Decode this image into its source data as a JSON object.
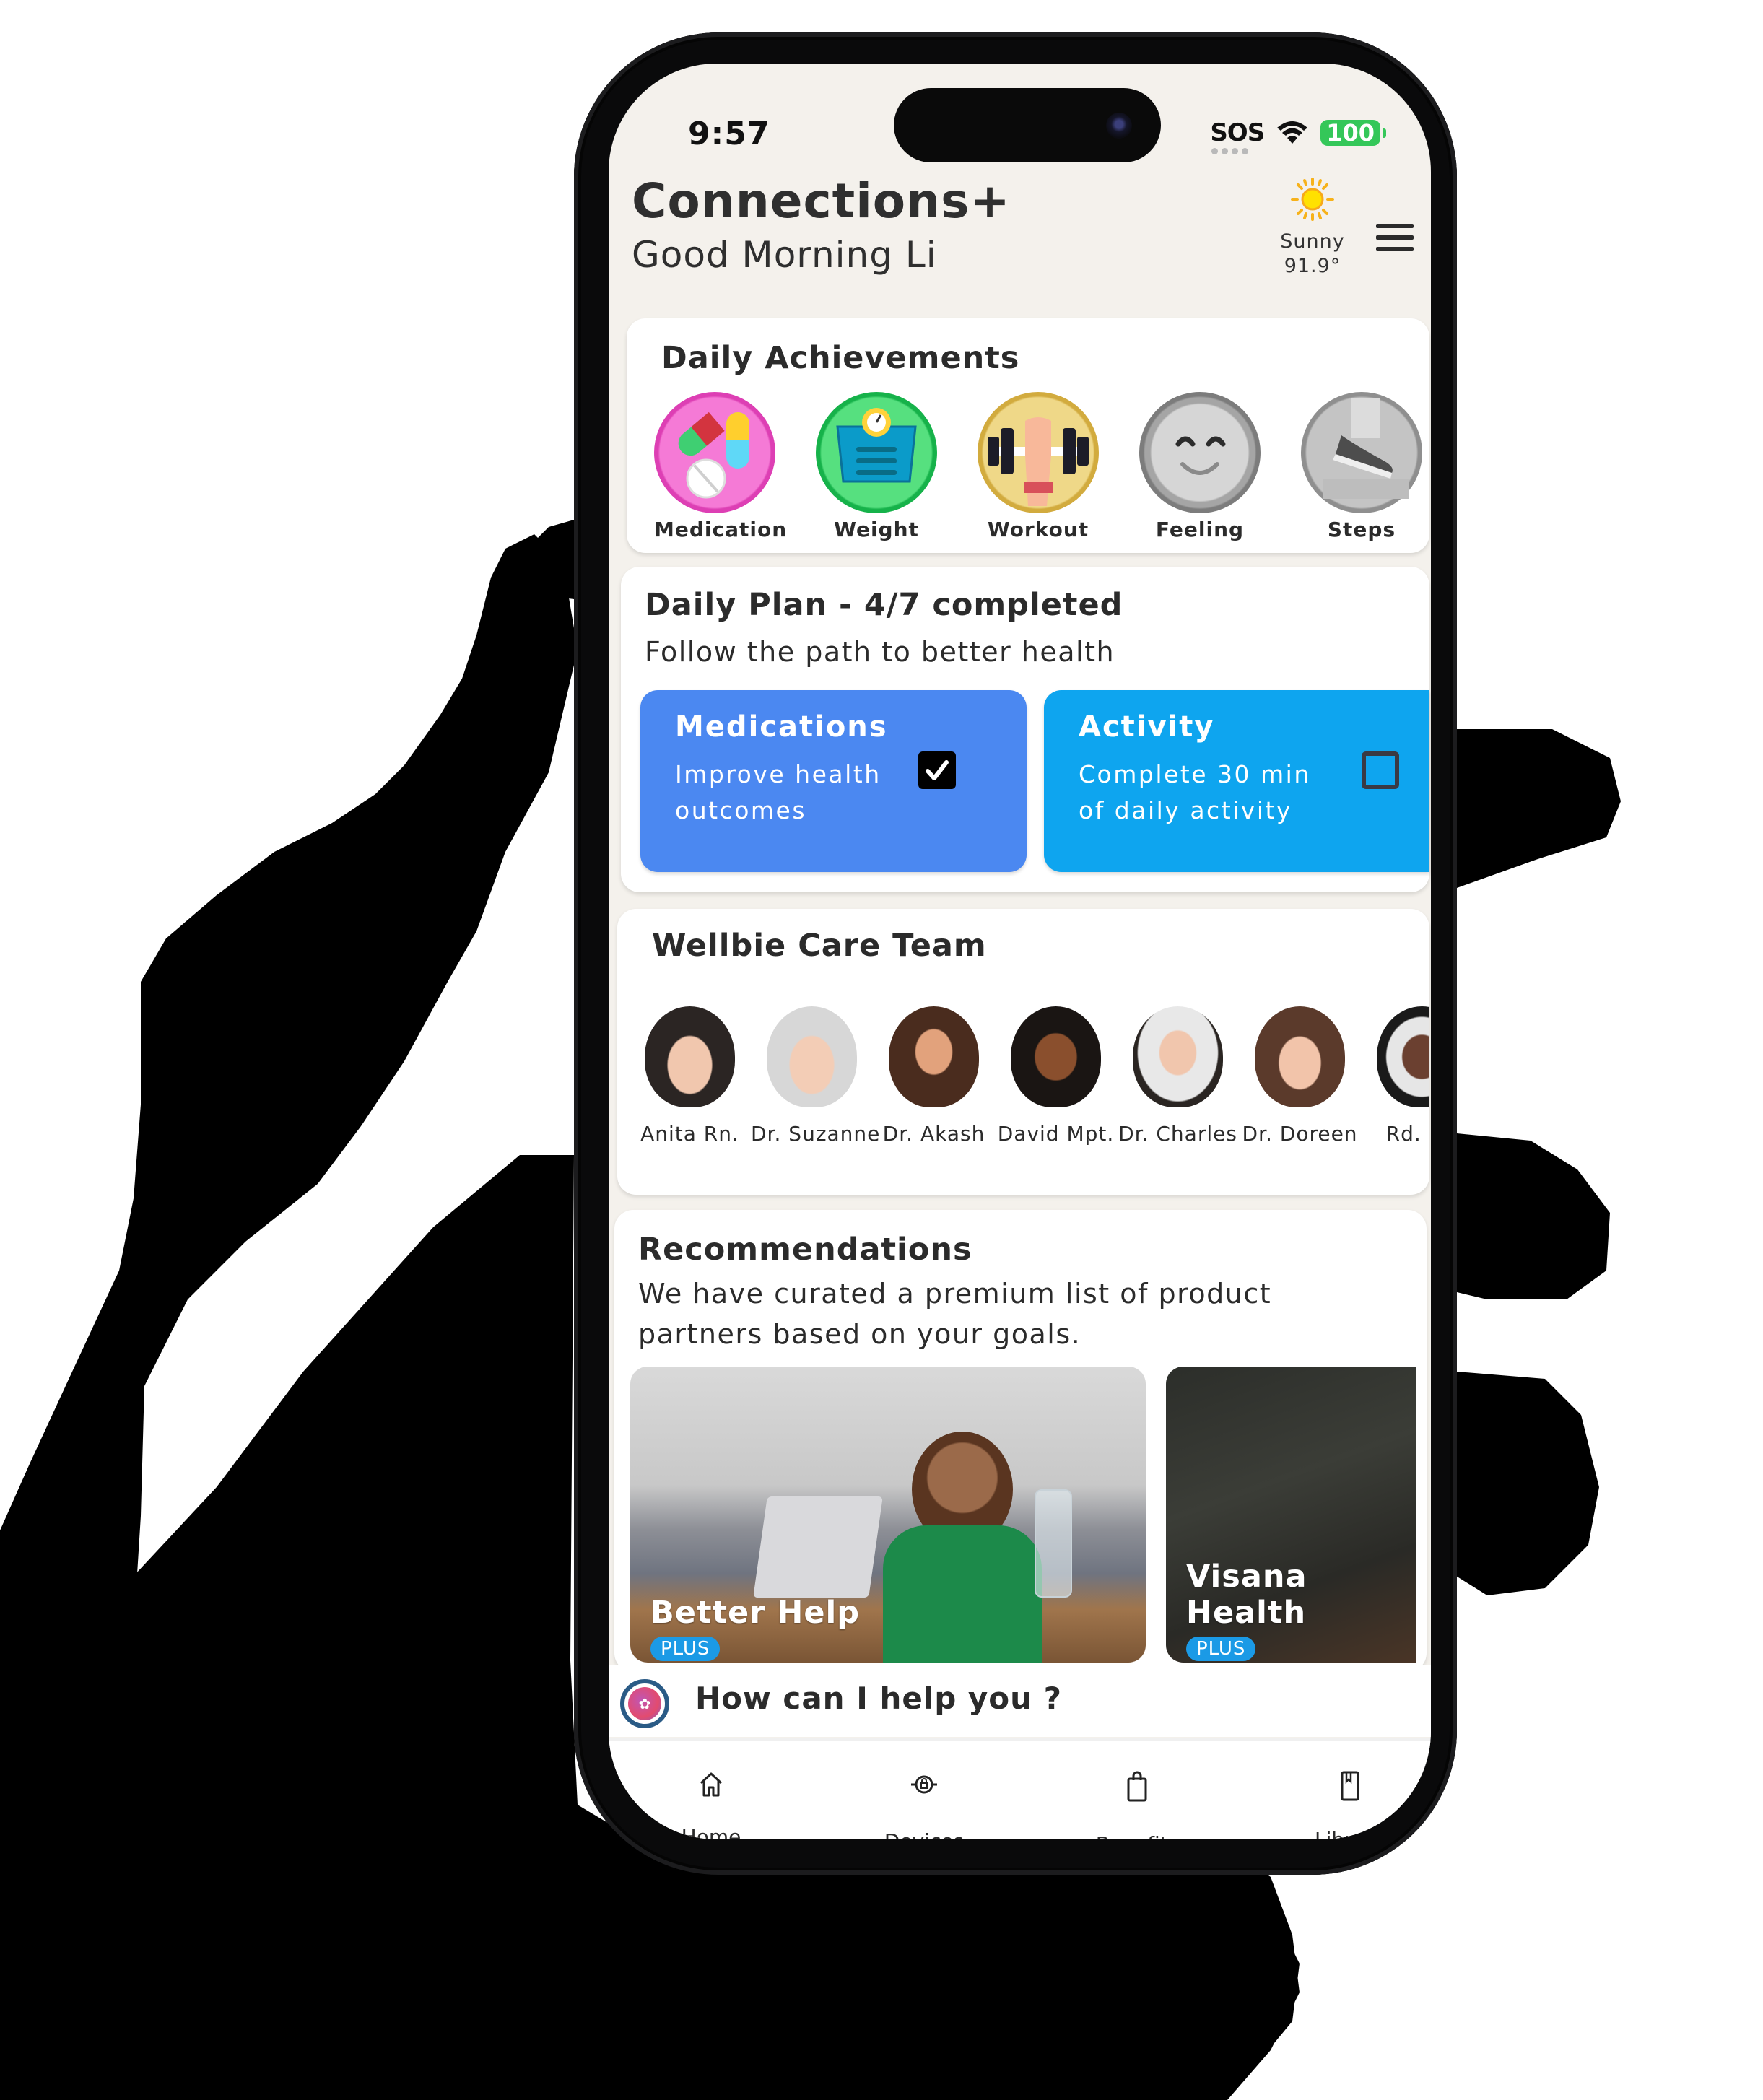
{
  "status_bar": {
    "time": "9:57",
    "carrier": "SOS",
    "battery": "100"
  },
  "header": {
    "app_title": "Connections+",
    "greeting": "Good Morning Li",
    "weather": {
      "icon": "sun-icon",
      "condition": "Sunny",
      "temperature": "91.9°"
    },
    "menu_icon": "hamburger-menu-icon"
  },
  "achievements": {
    "title": "Daily Achievements",
    "items": [
      {
        "label": "Medication",
        "icon": "pills-icon",
        "color": "#e94fbf",
        "state": "earned"
      },
      {
        "label": "Weight",
        "icon": "scale-icon",
        "color": "#2ecc63",
        "state": "earned"
      },
      {
        "label": "Workout",
        "icon": "dumbbell-icon",
        "color": "#e3c25a",
        "state": "earned"
      },
      {
        "label": "Feeling",
        "icon": "smiley-icon",
        "color": "#9a9a9a",
        "state": "locked"
      },
      {
        "label": "Steps",
        "icon": "shoe-icon",
        "color": "#a8a8a8",
        "state": "locked"
      }
    ]
  },
  "daily_plan": {
    "title": "Daily Plan - 4/7 completed",
    "completed": 4,
    "total": 7,
    "subtitle": "Follow the path to better health",
    "tasks": [
      {
        "title": "Medications",
        "description": "Improve health outcomes",
        "checked": true,
        "color": "#4b88f1"
      },
      {
        "title": "Activity",
        "description": "Complete 30 min of daily activity",
        "checked": false,
        "color": "#0ea5ef"
      }
    ]
  },
  "care_team": {
    "title": "Wellbie Care Team",
    "members": [
      {
        "name": "Anita Rn."
      },
      {
        "name": "Dr. Suzanne"
      },
      {
        "name": "Dr. Akash"
      },
      {
        "name": "David Mpt."
      },
      {
        "name": "Dr. Charles"
      },
      {
        "name": "Dr. Doreen"
      },
      {
        "name": "Rd. Da"
      }
    ]
  },
  "recommendations": {
    "title": "Recommendations",
    "subtitle": "We have curated a premium list of product partners based on your goals.",
    "items": [
      {
        "name": "Better Help",
        "badge": "PLUS"
      },
      {
        "name": "Visana Health",
        "badge": "PLUS"
      }
    ]
  },
  "assistant": {
    "prompt": "How can I help you ?"
  },
  "bottom_nav": {
    "items": [
      {
        "label": "Home",
        "icon": "home-icon"
      },
      {
        "label": "Devices",
        "icon": "devices-icon"
      },
      {
        "label": "Benefits",
        "icon": "shopping-bag-icon"
      },
      {
        "label": "Library",
        "icon": "book-icon"
      }
    ]
  }
}
